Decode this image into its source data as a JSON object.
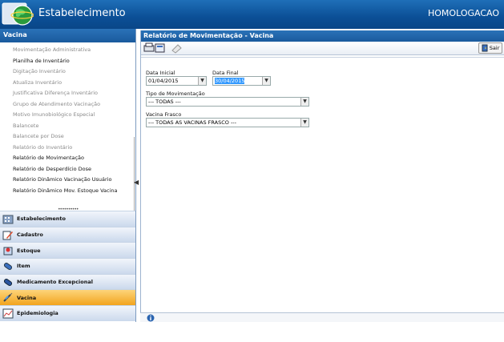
{
  "header": {
    "title": "Estabelecimento",
    "environment": "HOMOLOGACAO"
  },
  "sidebar": {
    "title": "Vacina",
    "items": [
      {
        "label": "Movimentação Administrativa",
        "enabled": false
      },
      {
        "label": "Planilha de Inventário",
        "enabled": true
      },
      {
        "label": "Digitação Inventário",
        "enabled": false
      },
      {
        "label": "Atualiza Inventário",
        "enabled": false
      },
      {
        "label": "Justificativa Diferença Inventário",
        "enabled": false
      },
      {
        "label": "Grupo de Atendimento Vacinação",
        "enabled": false
      },
      {
        "label": "Motivo Imunobiológico Especial",
        "enabled": false
      },
      {
        "label": "Balancete",
        "enabled": false
      },
      {
        "label": "Balancete por Dose",
        "enabled": false
      },
      {
        "label": "Relatório do Inventário",
        "enabled": false
      },
      {
        "label": "Relatório de Movimentação",
        "enabled": true
      },
      {
        "label": "Relatório de Desperdício Dose",
        "enabled": true
      },
      {
        "label": "Relatório Dinâmico Vacinação Usuário",
        "enabled": true
      },
      {
        "label": "Relatório Dinâmico Mov. Estoque Vacina",
        "enabled": true
      }
    ],
    "modules": [
      {
        "label": "Estabelecimento",
        "icon": "building-icon",
        "active": false
      },
      {
        "label": "Cadastro",
        "icon": "edit-icon",
        "active": false
      },
      {
        "label": "Estoque",
        "icon": "stock-icon",
        "active": false
      },
      {
        "label": "Item",
        "icon": "pill-icon",
        "active": false
      },
      {
        "label": "Medicamento Excepcional",
        "icon": "capsule-icon",
        "active": false
      },
      {
        "label": "Vacina",
        "icon": "syringe-icon",
        "active": true
      },
      {
        "label": "Epidemiologia",
        "icon": "chart-icon",
        "active": false
      }
    ]
  },
  "main": {
    "title": "Relatório de Movimentação - Vacina",
    "toolbar": {
      "exit_label": "Sair"
    },
    "form": {
      "start_date_label": "Data Inicial",
      "start_date_value": "01/04/2015",
      "end_date_label": "Data Final",
      "end_date_value": "30/04/2015",
      "movement_type_label": "Tipo de Movimentação",
      "movement_type_value": "--- TODAS ---",
      "vaccine_label": "Vacina Frasco",
      "vaccine_value": "--- TODAS AS VACINAS FRASCO ---"
    }
  },
  "colors": {
    "header_blue": "#0b4f96",
    "active_module": "#f2a41e",
    "selection": "#3399ff"
  }
}
